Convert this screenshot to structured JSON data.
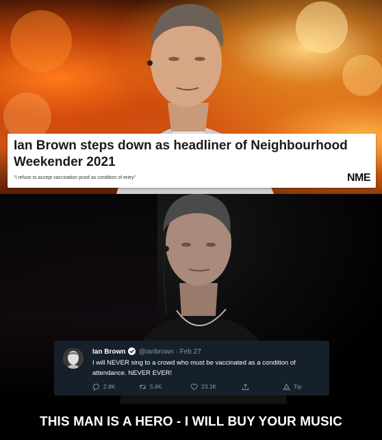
{
  "article": {
    "headline": "Ian Brown steps down as headliner of Neighbourhood Weekender 2021",
    "subhead": "\"I refuse to accept vaccination proof as condition of entry\"",
    "publisher": "NME"
  },
  "tweet": {
    "name": "Ian Brown",
    "handle_date": "@ianbrown · Feb 27",
    "text": "I will NEVER sing to a crowd who must be vaccinated as a condition of attendance. NEVER EVER!",
    "reply_count": "2.8K",
    "retweet_count": "5.6K",
    "like_count": "23.1K",
    "tip_label": "Tip",
    "icons": {
      "verified": "verified-badge-icon",
      "reply": "speech-bubble-icon",
      "retweet": "retweet-arrows-icon",
      "like": "heart-icon",
      "share": "share-upload-icon",
      "tip": "tip-triangle-icon"
    },
    "colors": {
      "card_background": "#15202b",
      "text": "#ffffff",
      "muted": "#8899a6",
      "verified": "#1da1f2"
    }
  },
  "caption": "THIS MAN IS A HERO - I WILL BUY YOUR MUSIC"
}
